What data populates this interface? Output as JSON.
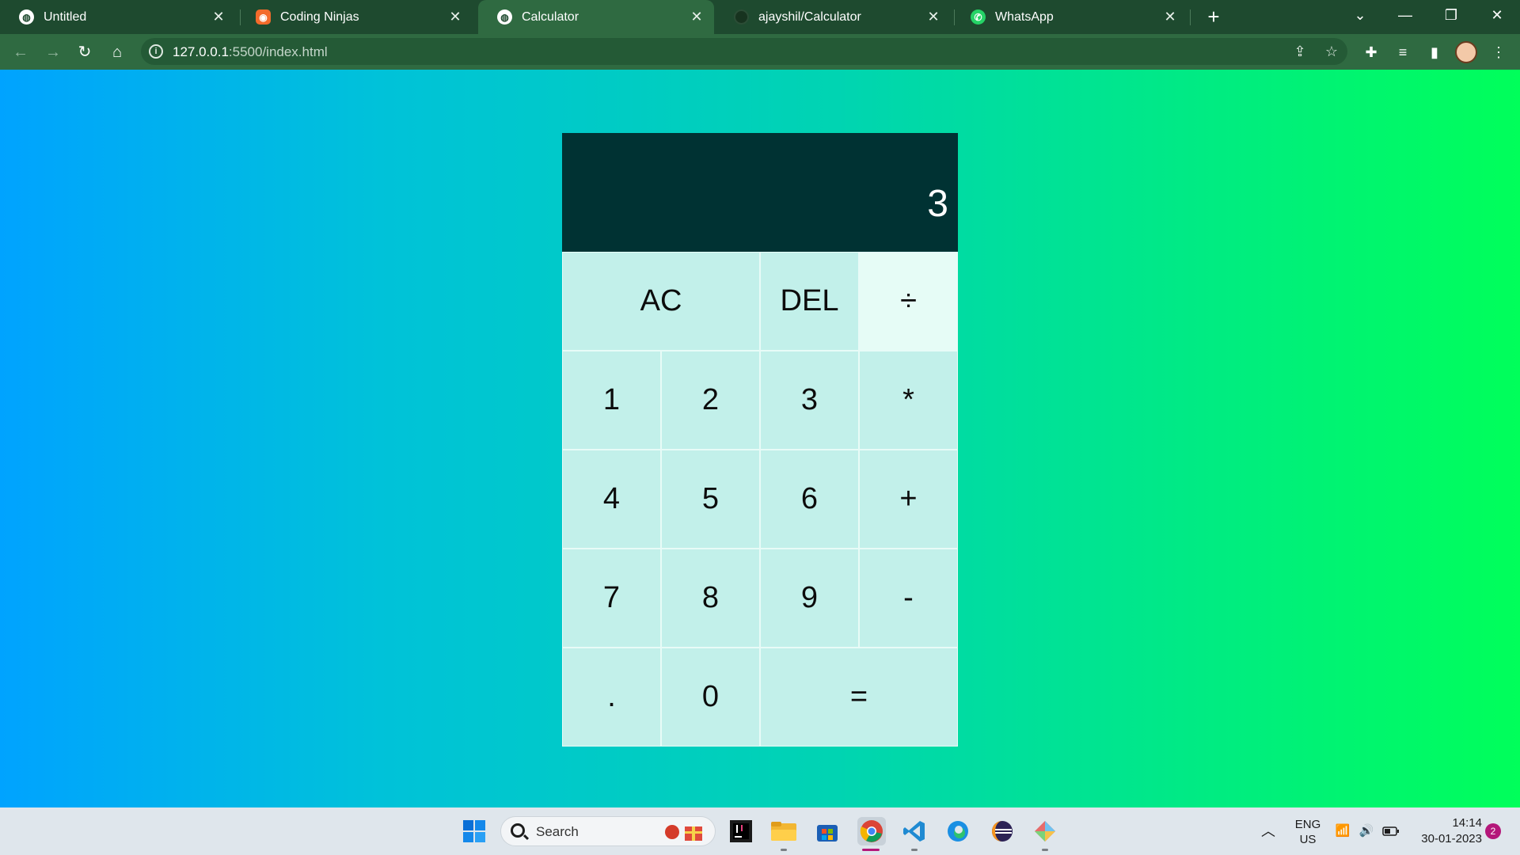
{
  "browser": {
    "tabs": [
      {
        "title": "Untitled",
        "icon": "globe-icon",
        "active": false
      },
      {
        "title": "Coding Ninjas",
        "icon": "coding-ninjas-icon",
        "active": false
      },
      {
        "title": "Calculator",
        "icon": "globe-icon",
        "active": true
      },
      {
        "title": "ajayshil/Calculator",
        "icon": "github-icon",
        "active": false
      },
      {
        "title": "WhatsApp",
        "icon": "whatsapp-icon",
        "active": false
      }
    ],
    "new_tab": "+",
    "url_host": "127.0.0.1",
    "url_path": ":5500/index.html"
  },
  "calculator": {
    "display": "3",
    "keys": {
      "ac": "AC",
      "del": "DEL",
      "divide": "÷",
      "one": "1",
      "two": "2",
      "three": "3",
      "multiply": "*",
      "four": "4",
      "five": "5",
      "six": "6",
      "plus": "+",
      "seven": "7",
      "eight": "8",
      "nine": "9",
      "minus": "-",
      "dot": ".",
      "zero": "0",
      "equals": "="
    },
    "colors": {
      "display_bg": "#003233",
      "key_bg": "#c2f0ea",
      "key_hover_bg": "#e6fcf6"
    }
  },
  "taskbar": {
    "search_placeholder": "Search",
    "lang_top": "ENG",
    "lang_bottom": "US",
    "time": "14:14",
    "date": "30-01-2023",
    "notification_count": "2"
  }
}
